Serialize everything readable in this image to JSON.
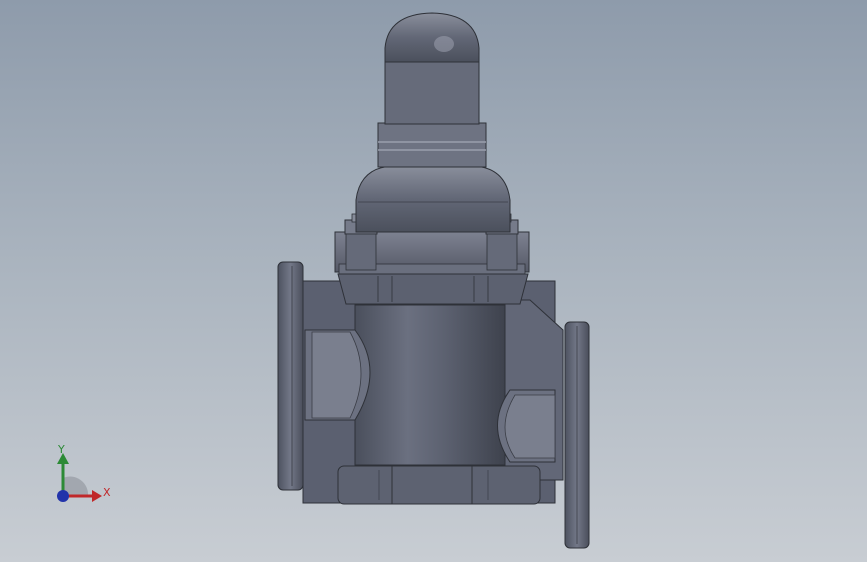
{
  "viewport": {
    "background_top": "#8e9bab",
    "background_bottom": "#c8cdd3",
    "model_color": "#5e6372"
  },
  "triad": {
    "x_label": "X",
    "y_label": "Y",
    "x_color": "#c0282a",
    "y_color": "#2c8a36",
    "z_color": "#2233aa",
    "icon": "coordinate-triad-icon"
  }
}
